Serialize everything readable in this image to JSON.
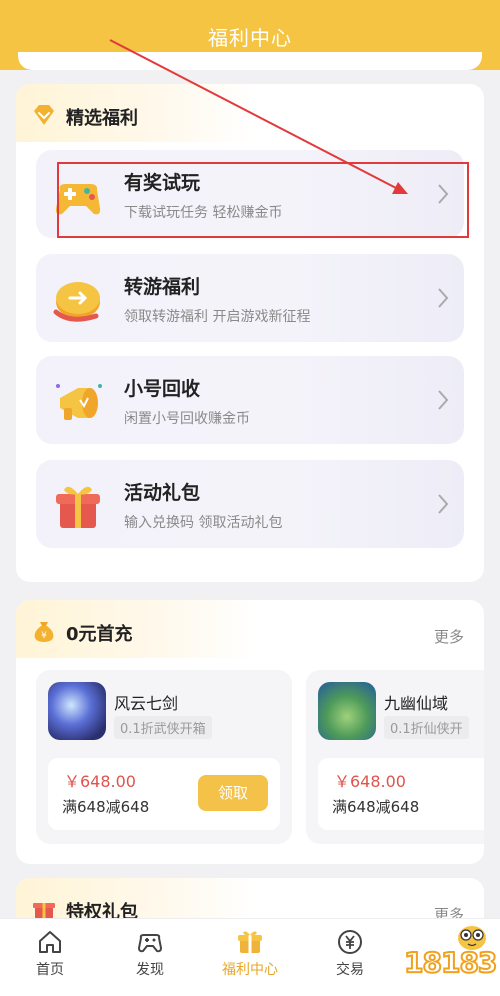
{
  "header": {
    "title": "福利中心"
  },
  "welfare_section": {
    "title": "精选福利",
    "items": [
      {
        "name": "有奖试玩",
        "desc": "下载试玩任务 轻松赚金币",
        "icon": "gamepad-icon"
      },
      {
        "name": "转游福利",
        "desc": "领取转游福利 开启游戏新征程",
        "icon": "coin-transfer-icon"
      },
      {
        "name": "小号回收",
        "desc": "闲置小号回收赚金币",
        "icon": "megaphone-icon"
      },
      {
        "name": "活动礼包",
        "desc": "输入兑换码 领取活动礼包",
        "icon": "gift-box-icon"
      }
    ]
  },
  "first_charge": {
    "title": "0元首充",
    "more": "更多",
    "games": [
      {
        "name": "风云七剑",
        "tag": "0.1折武侠开箱",
        "price": "￥648.00",
        "rule": "满648减648",
        "button": "领取"
      },
      {
        "name": "九幽仙域",
        "tag": "0.1折仙侠开",
        "price": "￥648.00",
        "rule": "满648减648"
      }
    ]
  },
  "privilege_section": {
    "title": "特权礼包",
    "more": "更多"
  },
  "tabbar": {
    "tabs": [
      {
        "label": "首页",
        "icon": "home-icon"
      },
      {
        "label": "发现",
        "icon": "gamepad-icon"
      },
      {
        "label": "福利中心",
        "icon": "gift-icon",
        "active": true
      },
      {
        "label": "交易",
        "icon": "yen-icon"
      }
    ]
  },
  "watermark": {
    "text": "18183"
  },
  "colors": {
    "brand": "#f6c443",
    "accent_text": "#e6a72a",
    "price": "#e0544d",
    "annotation": "#e23a3a"
  }
}
